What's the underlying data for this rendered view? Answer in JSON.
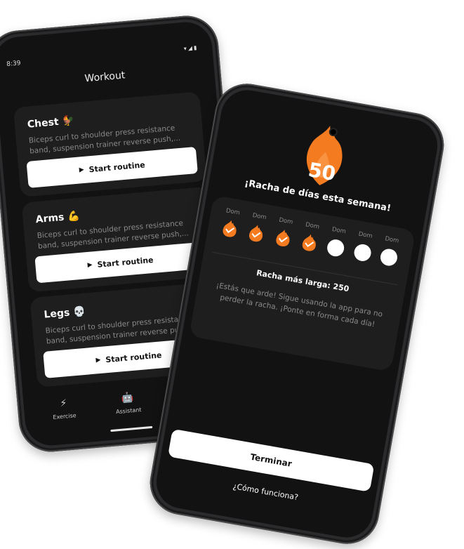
{
  "phone_left": {
    "status_time": "8:39",
    "status_icons": "▾◢▮",
    "title": "Workout",
    "cards": [
      {
        "name": "Chest",
        "emoji": "🐓",
        "desc": "Biceps curl to shoulder press resistance band, suspension trainer reverse push,...",
        "button": "Start routine"
      },
      {
        "name": "Arms",
        "emoji": "💪",
        "desc": "Biceps curl to shoulder press resistance band, suspension trainer reverse push,...",
        "button": "Start routine"
      },
      {
        "name": "Legs",
        "emoji": "💀",
        "desc": "Biceps curl to shoulder press resistance band, suspension trainer reverse push,...",
        "button": "Start routine"
      }
    ],
    "nav": [
      {
        "label": "Exercise",
        "icon": "bolt-icon",
        "glyph": "⚡"
      },
      {
        "label": "Assistant",
        "icon": "robot-icon",
        "glyph": "🤖"
      }
    ]
  },
  "phone_right": {
    "streak_number": "50",
    "title": "¡Racha de días esta semana!",
    "days": [
      {
        "label": "Dom",
        "done": true
      },
      {
        "label": "Dom",
        "done": true
      },
      {
        "label": "Dom",
        "done": true
      },
      {
        "label": "Dom",
        "done": true
      },
      {
        "label": "Dom",
        "done": false
      },
      {
        "label": "Dom",
        "done": false
      },
      {
        "label": "Dom",
        "done": false
      }
    ],
    "longest": "Racha más larga: 250",
    "message": "¡Estás que arde! Sigue usando la app para no perder la racha. ¡Ponte en forma cada día!",
    "finish_button": "Terminar",
    "how_link": "¿Cómo funciona?"
  },
  "colors": {
    "accent": "#F47B20",
    "background": "#121212",
    "card": "#1E1E1F",
    "text_muted": "#8A8A8C"
  }
}
